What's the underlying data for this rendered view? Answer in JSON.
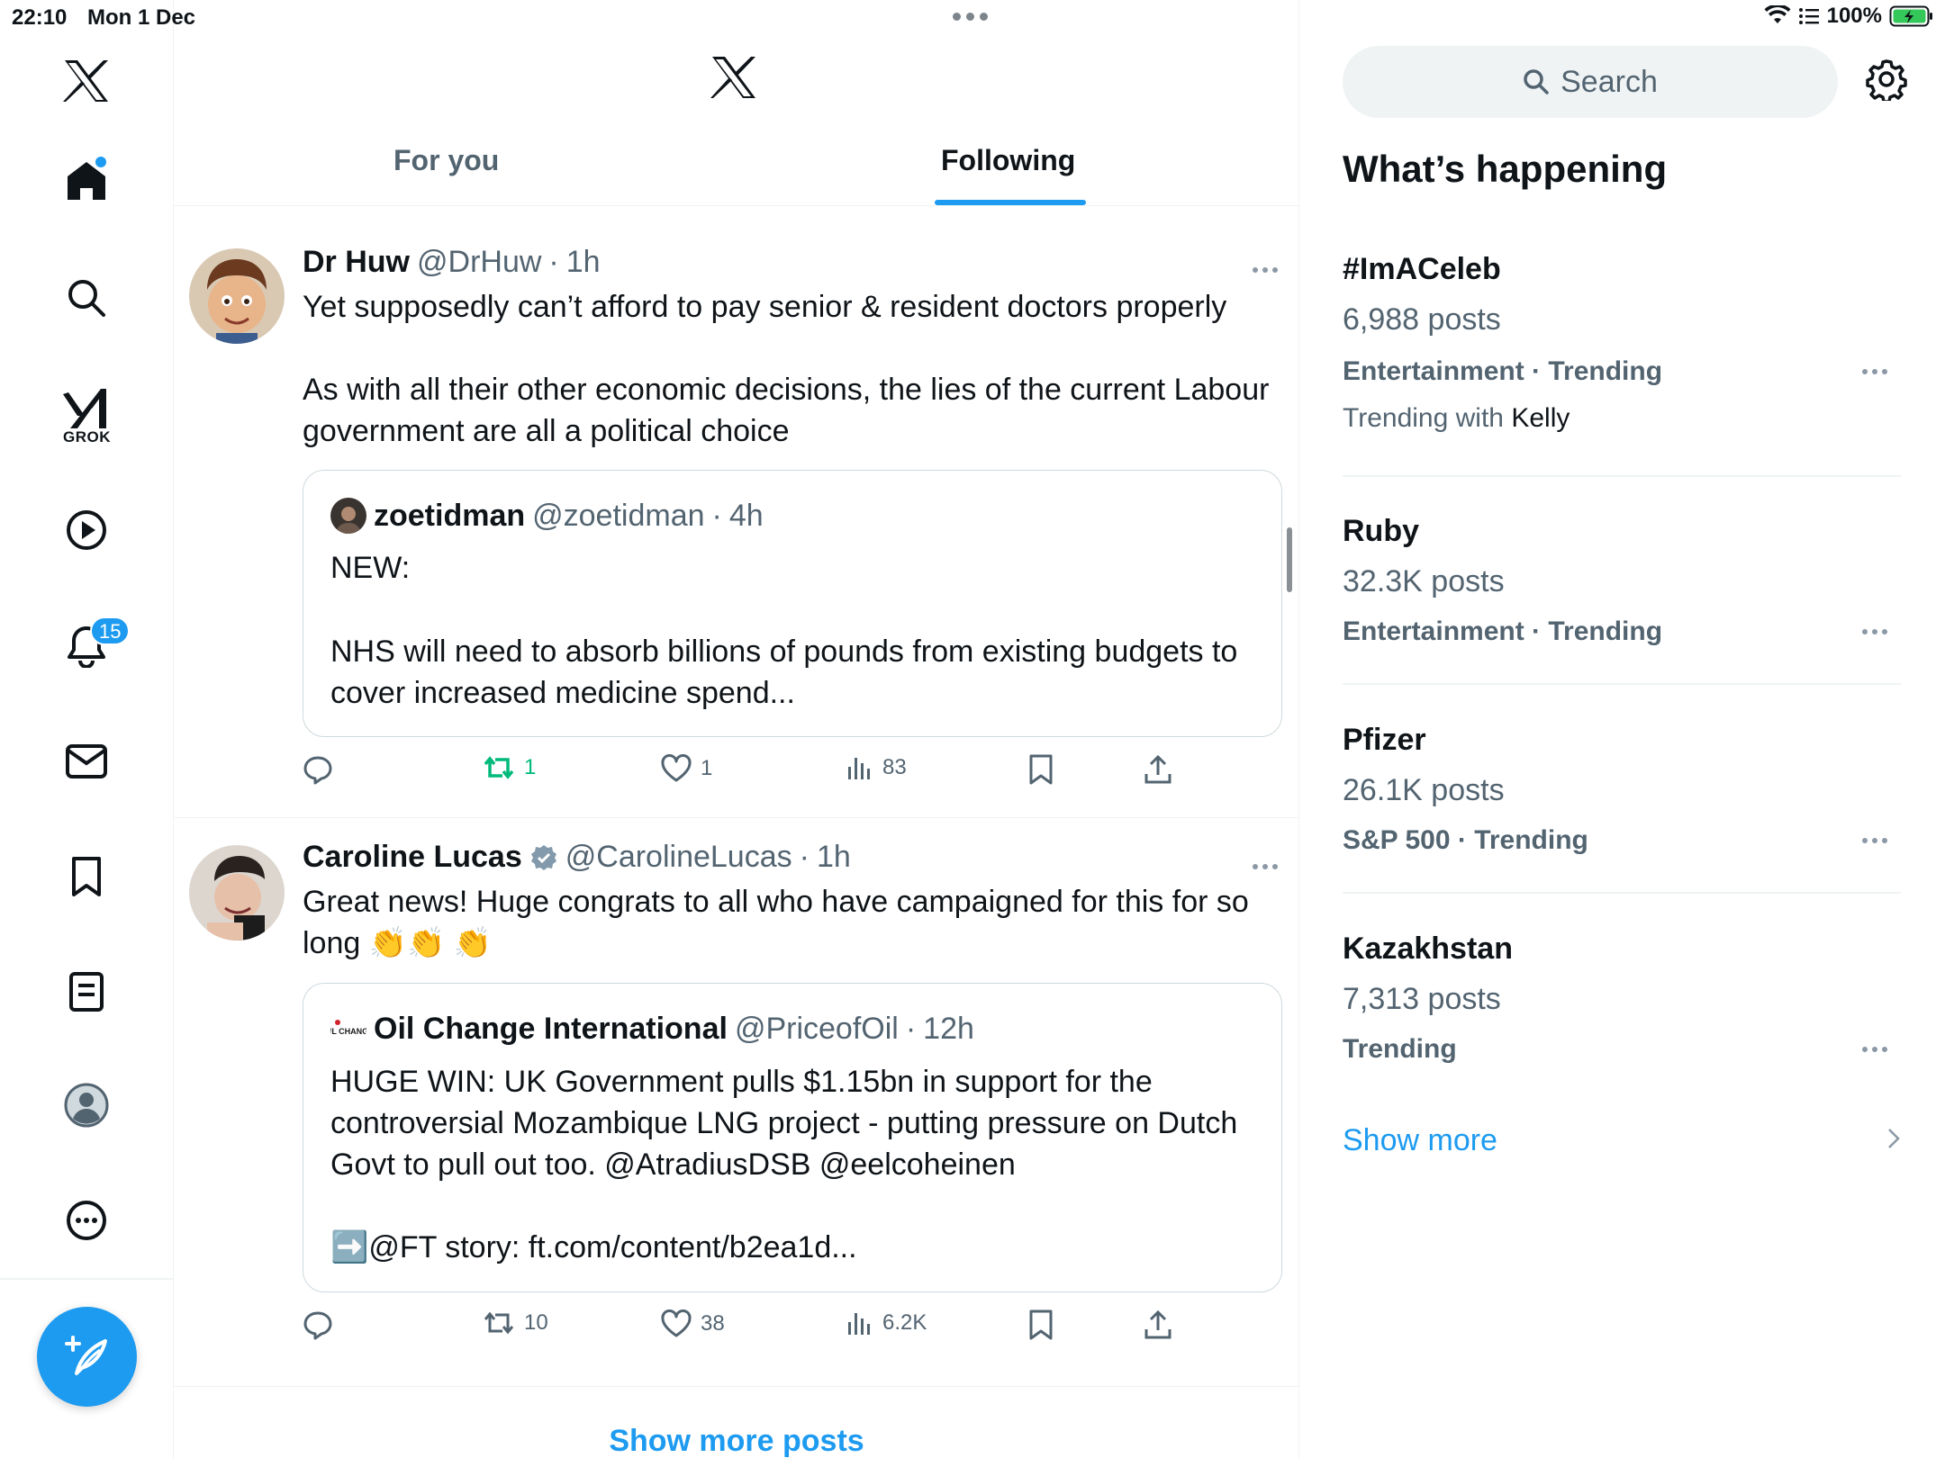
{
  "status_bar": {
    "time": "22:10",
    "date": "Mon 1 Dec",
    "battery": "100%"
  },
  "nav": {
    "grok_label": "GROK",
    "notifications_badge": "15",
    "icons": [
      "x-logo-icon",
      "home-icon",
      "search-icon",
      "grok-icon",
      "video-icon",
      "bell-icon",
      "mail-icon",
      "bookmark-icon",
      "lists-icon",
      "profile-icon",
      "more-icon",
      "compose-icon"
    ]
  },
  "feed": {
    "tabs": [
      {
        "label": "For you",
        "active": false
      },
      {
        "label": "Following",
        "active": true
      }
    ],
    "posts": [
      {
        "author": "Dr Huw",
        "handle": "@DrHuw",
        "sep": "·",
        "time": "1h",
        "text_1": "Yet supposedly can’t afford to pay senior & resident doctors properly",
        "text_2": "As with all their other economic decisions, the lies of the current Labour government are all a political choice",
        "quote": {
          "author": "zoetidman",
          "handle": "@zoetidman",
          "sep": "·",
          "time": "4h",
          "text_1": "NEW:",
          "text_2": "NHS will need to absorb billions of pounds from existing budgets to cover increased medicine spend..."
        },
        "stats": {
          "replies": "",
          "reposts": "1",
          "likes": "1",
          "views": "83"
        }
      },
      {
        "author": "Caroline Lucas",
        "handle": "@CarolineLucas",
        "sep": "·",
        "time": "1h",
        "text_1": "Great news!  Huge congrats to all who have campaigned for this for so long 👏👏 👏",
        "quote": {
          "logo_text": "OIL CHANGE",
          "author": "Oil Change International",
          "handle": "@PriceofOil",
          "sep": "·",
          "time": "12h",
          "text_1": "HUGE WIN: UK Government pulls $1.15bn in support for the controversial Mozambique LNG project - putting pressure on Dutch Govt to pull out too. @AtradiusDSB @eelcoheinen",
          "text_2": "➡️@FT story: ft.com/content/b2ea1d..."
        },
        "stats": {
          "replies": "",
          "reposts": "10",
          "likes": "38",
          "views": "6.2K"
        }
      }
    ],
    "show_more_posts": "Show more posts"
  },
  "sidebar": {
    "search_placeholder": "Search",
    "title": "What’s happening",
    "trends": [
      {
        "name": "#ImACeleb",
        "posts": "6,988 posts",
        "category": "Entertainment · Trending",
        "with_prefix": "Trending with",
        "with_name": "Kelly"
      },
      {
        "name": "Ruby",
        "posts": "32.3K posts",
        "category": "Entertainment · Trending"
      },
      {
        "name": "Pfizer",
        "posts": "26.1K posts",
        "category": "S&P 500 · Trending"
      },
      {
        "name": "Kazakhstan",
        "posts": "7,313 posts",
        "category": "Trending"
      }
    ],
    "show_more": "Show more"
  },
  "colors": {
    "accent": "#1d9bf0",
    "repost_active": "#00ba7c",
    "secondary_text": "#536471"
  }
}
